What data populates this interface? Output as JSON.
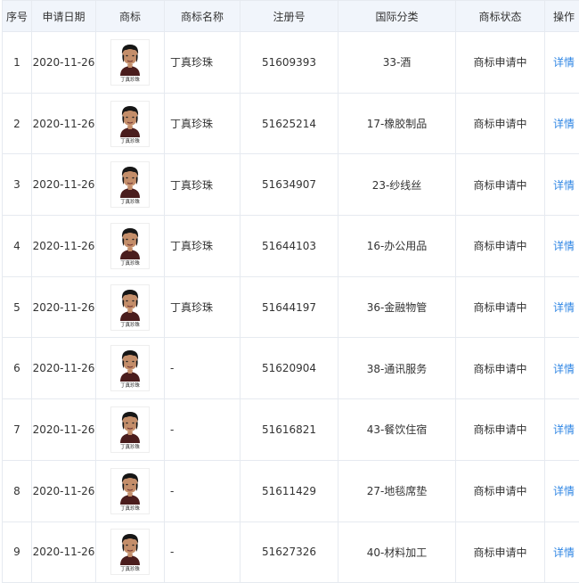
{
  "columns": {
    "index": "序号",
    "date": "申请日期",
    "logo": "商标",
    "name": "商标名称",
    "reg_no": "注册号",
    "class": "国际分类",
    "status": "商标状态",
    "action": "操作"
  },
  "rows": [
    {
      "index": "1",
      "date": "2020-11-26",
      "logo_text": "丁真珍珠",
      "name": "丁真珍珠",
      "reg_no": "51609393",
      "class": "33-酒",
      "status": "商标申请中",
      "action": "详情"
    },
    {
      "index": "2",
      "date": "2020-11-26",
      "logo_text": "丁真珍珠",
      "name": "丁真珍珠",
      "reg_no": "51625214",
      "class": "17-橡胶制品",
      "status": "商标申请中",
      "action": "详情"
    },
    {
      "index": "3",
      "date": "2020-11-26",
      "logo_text": "丁真珍珠",
      "name": "丁真珍珠",
      "reg_no": "51634907",
      "class": "23-纱线丝",
      "status": "商标申请中",
      "action": "详情"
    },
    {
      "index": "4",
      "date": "2020-11-26",
      "logo_text": "丁真珍珠",
      "name": "丁真珍珠",
      "reg_no": "51644103",
      "class": "16-办公用品",
      "status": "商标申请中",
      "action": "详情"
    },
    {
      "index": "5",
      "date": "2020-11-26",
      "logo_text": "丁真珍珠",
      "name": "丁真珍珠",
      "reg_no": "51644197",
      "class": "36-金融物管",
      "status": "商标申请中",
      "action": "详情"
    },
    {
      "index": "6",
      "date": "2020-11-26",
      "logo_text": "丁真珍珠",
      "name": "-",
      "reg_no": "51620904",
      "class": "38-通讯服务",
      "status": "商标申请中",
      "action": "详情"
    },
    {
      "index": "7",
      "date": "2020-11-26",
      "logo_text": "丁真珍珠",
      "name": "-",
      "reg_no": "51616821",
      "class": "43-餐饮住宿",
      "status": "商标申请中",
      "action": "详情"
    },
    {
      "index": "8",
      "date": "2020-11-26",
      "logo_text": "丁真珍珠",
      "name": "-",
      "reg_no": "51611429",
      "class": "27-地毯席垫",
      "status": "商标申请中",
      "action": "详情"
    },
    {
      "index": "9",
      "date": "2020-11-26",
      "logo_text": "丁真珍珠",
      "name": "-",
      "reg_no": "51627326",
      "class": "40-材料加工",
      "status": "商标申请中",
      "action": "详情"
    }
  ],
  "colors": {
    "header_bg": "#f1f5fb",
    "border": "#e6eaf0",
    "link": "#2f86e4",
    "text": "#333333"
  },
  "icons": {
    "logo": "trademark-portrait-image"
  }
}
